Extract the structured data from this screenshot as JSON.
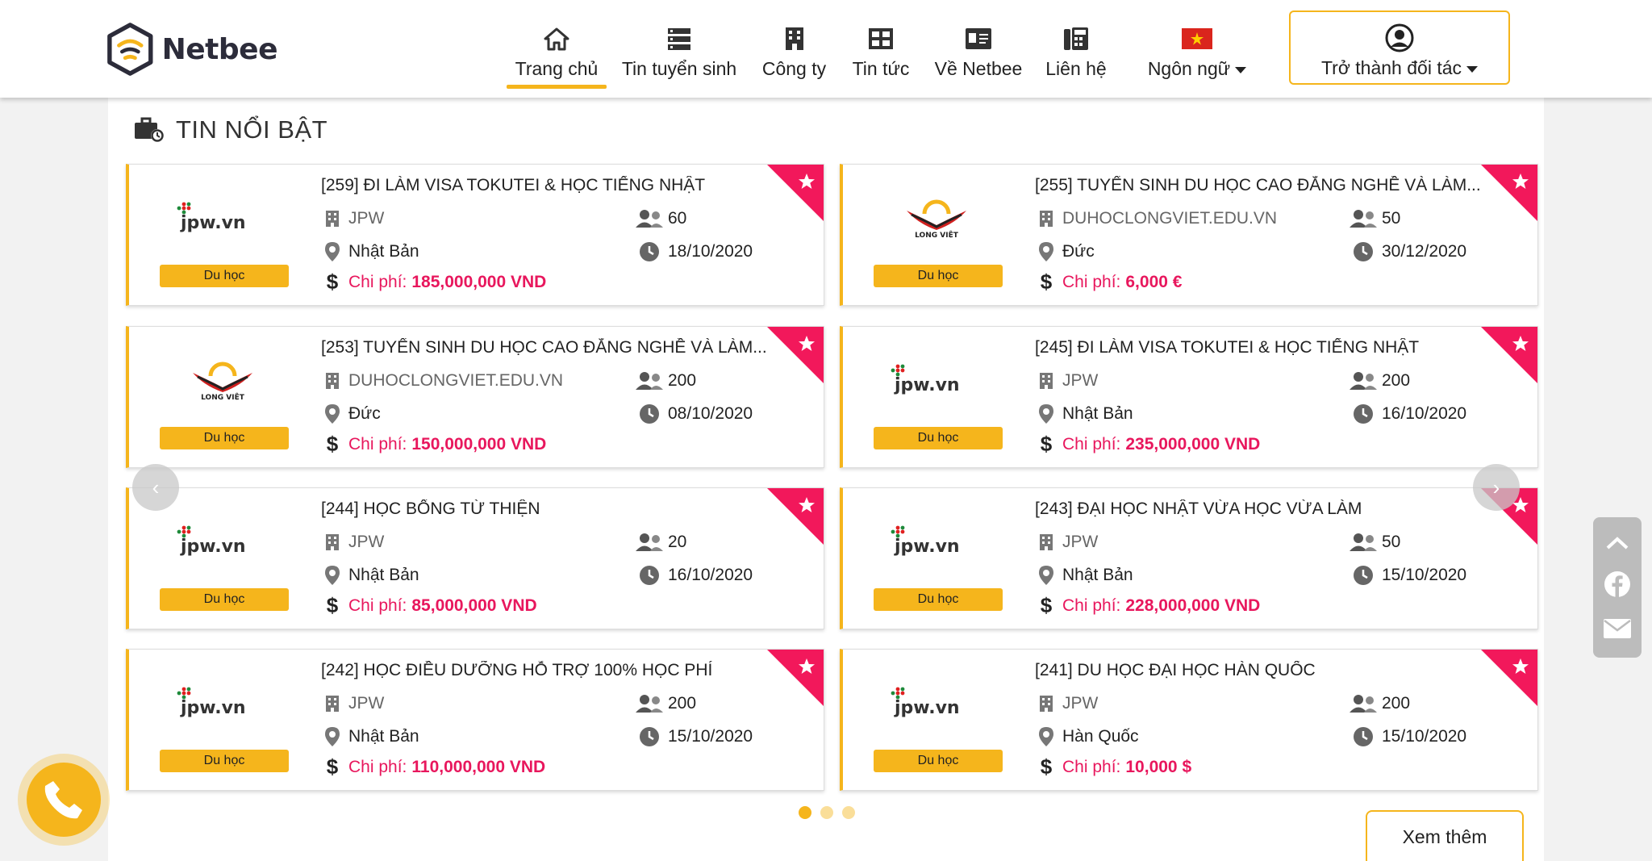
{
  "brand": {
    "name": "Netbee"
  },
  "nav": [
    {
      "label": "Trang chủ",
      "icon": "home-icon",
      "active": true
    },
    {
      "label": "Tin tuyển sinh",
      "icon": "list-icon"
    },
    {
      "label": "Công ty",
      "icon": "building-icon"
    },
    {
      "label": "Tin tức",
      "icon": "news-icon"
    },
    {
      "label": "Về Netbee",
      "icon": "id-card-icon"
    },
    {
      "label": "Liên hệ",
      "icon": "phone-fax-icon"
    },
    {
      "label": "Ngôn ngữ",
      "icon": "vietnam-flag-icon"
    }
  ],
  "partner": {
    "label": "Trở thành đối tác",
    "icon": "user-circle-icon"
  },
  "section": {
    "title": "TIN NỔI BẬT",
    "icon": "briefcase-clock-icon"
  },
  "labels": {
    "cost_prefix": "Chi phí:"
  },
  "cards": [
    {
      "title": "[259] ĐI LÀM VISA TOKUTEI & HỌC TIẾNG NHẬT",
      "logo": "jpw.vn",
      "badge": "Du học",
      "company": "JPW",
      "location": "Nhật Bản",
      "cost": "185,000,000 VND",
      "count": "60",
      "date": "18/10/2020"
    },
    {
      "title": "[255] TUYỂN SINH DU HỌC CAO ĐẲNG NGHỀ VÀ LÀM...",
      "logo": "LONG VIỆT",
      "badge": "Du học",
      "company": "DUHOCLONGVIET.EDU.VN",
      "location": "Đức",
      "cost": "6,000 €",
      "count": "50",
      "date": "30/12/2020"
    },
    {
      "title": "[253] TUYỂN SINH DU HỌC CAO ĐẲNG NGHỀ VÀ LÀM...",
      "logo": "LONG VIỆT",
      "badge": "Du học",
      "company": "DUHOCLONGVIET.EDU.VN",
      "location": "Đức",
      "cost": "150,000,000 VND",
      "count": "200",
      "date": "08/10/2020"
    },
    {
      "title": "[245] ĐI LÀM VISA TOKUTEI & HỌC TIẾNG NHẬT",
      "logo": "jpw.vn",
      "badge": "Du học",
      "company": "JPW",
      "location": "Nhật Bản",
      "cost": "235,000,000 VND",
      "count": "200",
      "date": "16/10/2020"
    },
    {
      "title": "[244] HỌC BỔNG TỪ THIỆN",
      "logo": "jpw.vn",
      "badge": "Du học",
      "company": "JPW",
      "location": "Nhật Bản",
      "cost": "85,000,000 VND",
      "count": "20",
      "date": "16/10/2020"
    },
    {
      "title": "[243] ĐẠI HỌC NHẬT VỪA HỌC VỪA LÀM",
      "logo": "jpw.vn",
      "badge": "Du học",
      "company": "JPW",
      "location": "Nhật Bản",
      "cost": "228,000,000 VND",
      "count": "50",
      "date": "15/10/2020"
    },
    {
      "title": "[242] HỌC ĐIỀU DƯỠNG HỖ TRỢ 100% HỌC PHÍ",
      "logo": "jpw.vn",
      "badge": "Du học",
      "company": "JPW",
      "location": "Nhật Bản",
      "cost": "110,000,000 VND",
      "count": "200",
      "date": "15/10/2020"
    },
    {
      "title": "[241] DU HỌC ĐẠI HỌC HÀN QUỐC",
      "logo": "jpw.vn",
      "badge": "Du học",
      "company": "JPW",
      "location": "Hàn Quốc",
      "cost": "10,000 $",
      "count": "200",
      "date": "15/10/2020"
    }
  ],
  "carousel": {
    "pages": 3,
    "active_page": 1,
    "prev_icon": "chevron-left-icon",
    "next_icon": "chevron-right-icon"
  },
  "more_button": {
    "label": "Xem thêm"
  },
  "floating": {
    "side_icons": [
      "chevron-up-icon",
      "facebook-icon",
      "mail-icon"
    ],
    "phone_icon": "phone-icon"
  },
  "colors": {
    "accent": "#f5b51c",
    "highlight": "#e8175d",
    "corner": "#f2185b"
  }
}
